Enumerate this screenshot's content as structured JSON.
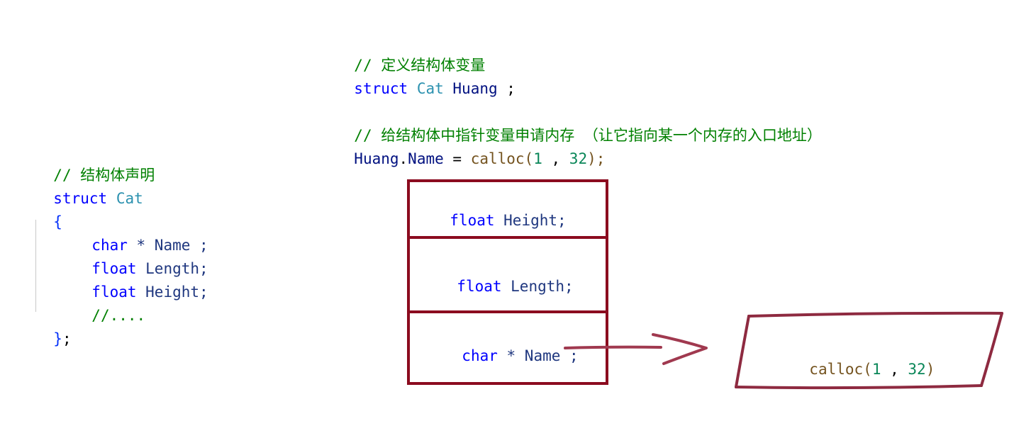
{
  "declaration": {
    "comment": "// 结构体声明",
    "kw_struct": "struct",
    "type_name": "Cat",
    "open_brace": "{",
    "field1_kw": "char",
    "field1_rest": " * Name ;",
    "field2_kw": "float",
    "field2_rest": " Length;",
    "field3_kw": "float",
    "field3_rest": " Height;",
    "ellipsis_comment": "//....",
    "close_brace": "}",
    "close_semicolon": ";"
  },
  "definition": {
    "comment1": "// 定义结构体变量",
    "kw_struct": "struct",
    "type_name": "Cat",
    "var_name": "Huang",
    "semicolon": " ;",
    "comment2": "// 给结构体中指针变量申请内存 （让它指向某一个内存的入口地址）",
    "assign_obj": "Huang",
    "assign_dot": ".",
    "assign_field": "Name",
    "assign_eq": " = ",
    "func": "calloc",
    "paren_open": "(",
    "arg1": "1",
    "comma": " , ",
    "arg2": "32",
    "paren_close": ");"
  },
  "memory_layout": {
    "cell1_kw": "float",
    "cell1_rest": " Height;",
    "cell2_kw": "float",
    "cell2_rest": " Length;",
    "cell3_kw": "char",
    "cell3_rest": " * Name ;"
  },
  "allocated_block": {
    "func": "calloc",
    "paren_open": "(",
    "arg1": "1",
    "comma": " , ",
    "arg2": "32",
    "paren_close": ")"
  },
  "colors": {
    "box_border": "#8b0b1f",
    "arrow": "#a0394f",
    "comment": "#008000",
    "keyword": "#0000ff",
    "type": "#2b91af"
  }
}
